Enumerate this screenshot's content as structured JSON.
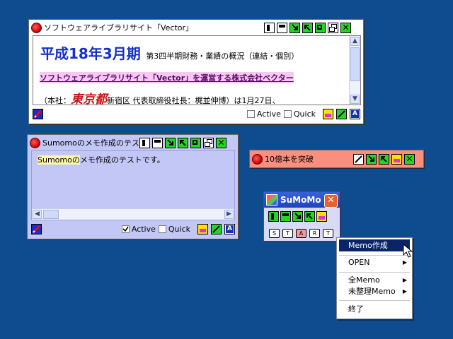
{
  "vector_window": {
    "title": "ソフトウェアライブラリサイト「Vector」",
    "headline": "平成18年3月期",
    "subhead": "第3四半期財務・業績の概況（連結・個別）",
    "link": "ソフトウェアライブラリサイト「Vector」を運営する株式会社ベクター",
    "addr_prefix": "（本社：",
    "city": "東京都",
    "addr_rest": "新宿区 代表取締役社長：梶並伸博）は1月27日、",
    "active_label": "Active",
    "quick_label": "Quick"
  },
  "sumomo_window": {
    "title": "Sumomoのメモ作成のテスト",
    "body_highlight": "Sumomoの",
    "body_rest": "メモ作成のテストです。",
    "active_label": "Active",
    "quick_label": "Quick"
  },
  "small_window": {
    "title": "10億本を突破"
  },
  "launcher": {
    "title": "SuMoMo",
    "tags": [
      "S",
      "T",
      "A",
      "R",
      "T"
    ]
  },
  "context_menu": {
    "items": [
      {
        "label": "Memo作成",
        "submenu": false
      },
      {
        "label": "OPEN",
        "submenu": true
      },
      {
        "label": "全Memo",
        "submenu": true
      },
      {
        "label": "未整理Memo",
        "submenu": true
      },
      {
        "label": "終了",
        "submenu": false
      }
    ]
  },
  "colors": {
    "desktop": "#0f4c8f",
    "vector_frame": "#ffffff",
    "sumomo_frame": "#c3c7f6",
    "small_frame": "#f88f7f",
    "button_green": "#24d624",
    "menu_highlight": "#0a246a"
  }
}
